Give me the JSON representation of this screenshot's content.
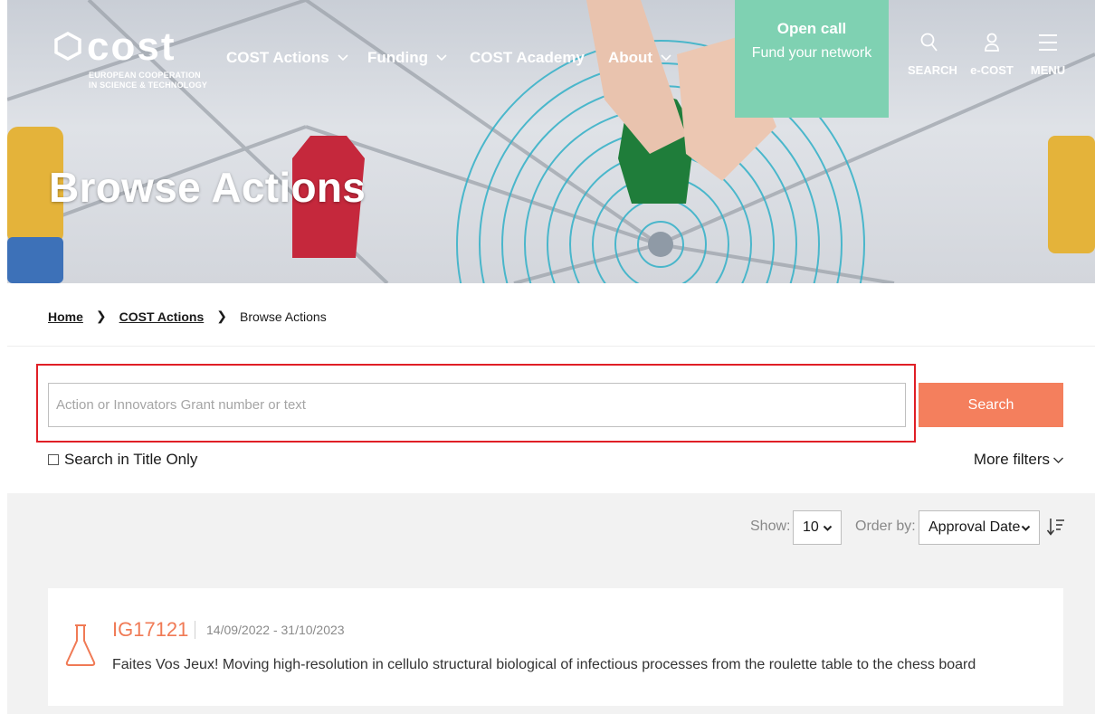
{
  "header": {
    "logo_word": "cost",
    "logo_tag_line1": "EUROPEAN COOPERATION",
    "logo_tag_line2": "IN SCIENCE & TECHNOLOGY",
    "nav": [
      {
        "label": "COST Actions",
        "has_dropdown": true
      },
      {
        "label": "Funding",
        "has_dropdown": true
      },
      {
        "label": "COST Academy",
        "has_dropdown": false
      },
      {
        "label": "About",
        "has_dropdown": true
      }
    ],
    "open_call": {
      "title": "Open call",
      "subtitle": "Fund your network"
    },
    "tools": [
      {
        "label": "SEARCH",
        "icon": "search-icon"
      },
      {
        "label": "e-COST",
        "icon": "user-icon"
      },
      {
        "label": "MENU",
        "icon": "hamburger-menu-icon"
      }
    ]
  },
  "hero": {
    "title": "Browse Actions"
  },
  "breadcrumb": [
    {
      "label": "Home",
      "link": true
    },
    {
      "label": "COST Actions",
      "link": true
    },
    {
      "label": "Browse Actions",
      "link": false
    }
  ],
  "search": {
    "placeholder": "Action or Innovators Grant number or text",
    "value": "",
    "button_label": "Search",
    "title_only_label": "Search in Title Only",
    "title_only_checked": false,
    "more_filters_label": "More filters"
  },
  "listing": {
    "show_label": "Show:",
    "show_value": "10",
    "order_label": "Order by:",
    "order_value": "Approval Date",
    "sort_icon": "sort-descending-icon"
  },
  "results": [
    {
      "code": "IG17121",
      "dates": "14/09/2022 - 31/10/2023",
      "title": "Faites Vos Jeux! Moving high-resolution in cellulo structural biological of infectious processes from the roulette table to the chess board",
      "icon": "flask-icon"
    }
  ],
  "colors": {
    "accent": "#f47f5d",
    "code": "#f07a55",
    "open_call_bg": "#7fd1b2",
    "highlight_border": "#e01f26"
  }
}
